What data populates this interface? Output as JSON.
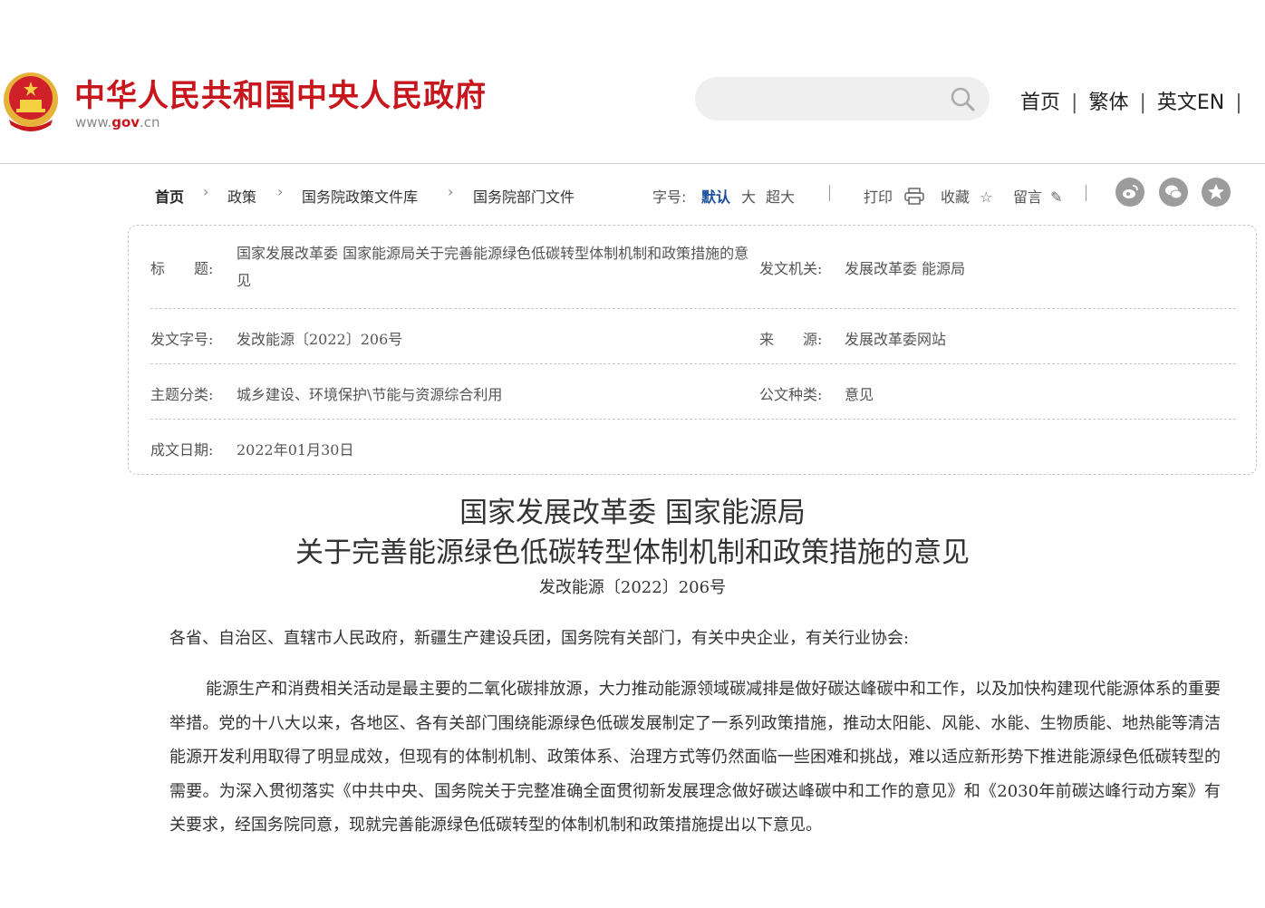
{
  "header": {
    "site_name": "中华人民共和国中央人民政府",
    "site_url_prefix": "www.",
    "site_url_domain": "gov",
    "site_url_suffix": ".cn",
    "search_placeholder": "",
    "nav": [
      "首页",
      "繁体",
      "英文EN"
    ],
    "nav_separator": "|",
    "brand_color": "#c8161d"
  },
  "toolbar": {
    "breadcrumb": [
      "首页",
      "政策",
      "国务院政策文件库",
      "国务院部门文件"
    ],
    "font_size_label": "字号:",
    "font_sizes": [
      "默认",
      "大",
      "超大"
    ],
    "print_label": "打印",
    "favorite_label": "收藏",
    "comment_label": "留言",
    "share_icons": [
      "weibo-icon",
      "wechat-icon",
      "favorite-icon"
    ]
  },
  "info": {
    "title_label": "标　　题:",
    "title_value": "国家发展改革委 国家能源局关于完善能源绿色低碳转型体制机制和政策措施的意见",
    "issuer_label": "发文机关:",
    "issuer_value": "发展改革委 能源局",
    "docno_label": "发文字号:",
    "docno_value": "发改能源〔2022〕206号",
    "source_label": "来　　源:",
    "source_value": "发展改革委网站",
    "topic_label": "主题分类:",
    "topic_value": "城乡建设、环境保护\\节能与资源综合利用",
    "type_label": "公文种类:",
    "type_value": "意见",
    "date_label": "成文日期:",
    "date_value": "2022年01月30日"
  },
  "article": {
    "title_line1": "国家发展改革委 国家能源局",
    "title_line2": "关于完善能源绿色低碳转型体制机制和政策措施的意见",
    "doc_number": "发改能源〔2022〕206号",
    "salutation": "各省、自治区、直辖市人民政府，新疆生产建设兵团，国务院有关部门，有关中央企业，有关行业协会:",
    "paragraph1": "能源生产和消费相关活动是最主要的二氧化碳排放源，大力推动能源领域碳减排是做好碳达峰碳中和工作，以及加快构建现代能源体系的重要举措。党的十八大以来，各地区、各有关部门围绕能源绿色低碳发展制定了一系列政策措施，推动太阳能、风能、水能、生物质能、地热能等清洁能源开发利用取得了明显成效，但现有的体制机制、政策体系、治理方式等仍然面临一些困难和挑战，难以适应新形势下推进能源绿色低碳转型的需要。为深入贯彻落实《中共中央、国务院关于完整准确全面贯彻新发展理念做好碳达峰碳中和工作的意见》和《2030年前碳达峰行动方案》有关要求，经国务院同意，现就完善能源绿色低碳转型的体制机制和政策措施提出以下意见。"
  }
}
